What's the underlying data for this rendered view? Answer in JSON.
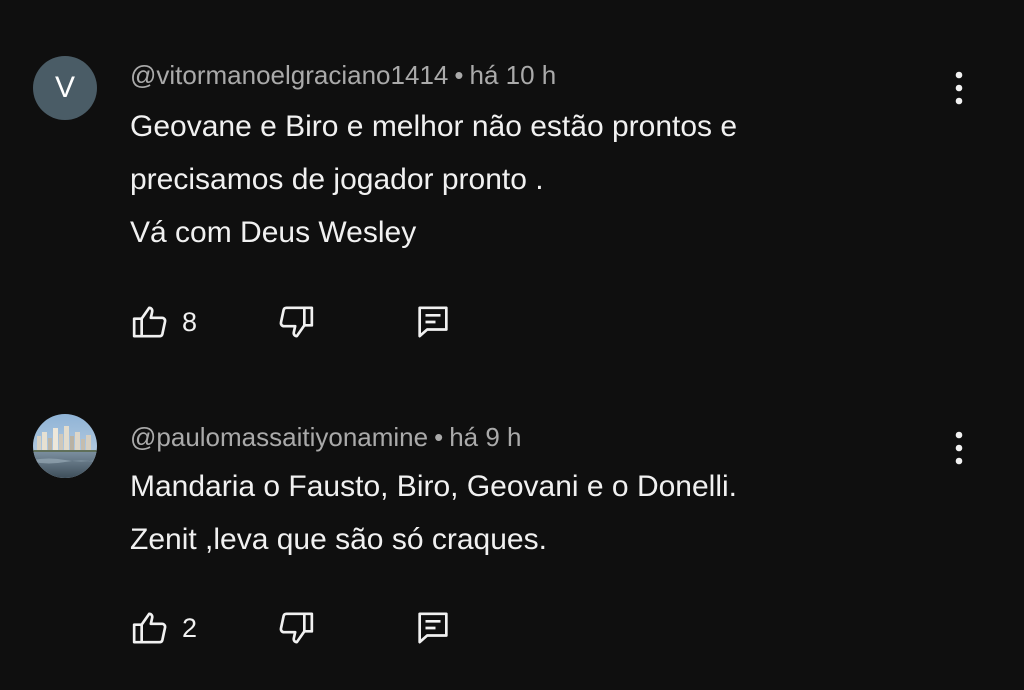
{
  "comments": [
    {
      "avatar_letter": "V",
      "avatar_color": "#4a5c66",
      "author": "@vitormanoelgraciano1414",
      "separator": "•",
      "time": "há 10 h",
      "lines": [
        "Geovane e Biro e melhor não estão prontos e",
        "precisamos de jogador pronto .",
        "Vá com Deus Wesley"
      ],
      "likes": "8",
      "icons": {
        "like": "thumbs-up-icon",
        "dislike": "thumbs-down-icon",
        "reply": "reply-icon",
        "menu": "more-vert-icon"
      }
    },
    {
      "avatar_image": "city skyline photo",
      "author": "@paulomassaitiyonamine",
      "separator": "•",
      "time": "há 9 h",
      "lines": [
        "Mandaria o Fausto, Biro, Geovani e o Donelli.",
        "Zenit ,leva que são só craques."
      ],
      "likes": "2",
      "icons": {
        "like": "thumbs-up-icon",
        "dislike": "thumbs-down-icon",
        "reply": "reply-icon",
        "menu": "more-vert-icon"
      }
    }
  ],
  "colors": {
    "background": "#0f0f0f",
    "text": "#f1f1f1",
    "meta_text": "#aaaaaa"
  }
}
